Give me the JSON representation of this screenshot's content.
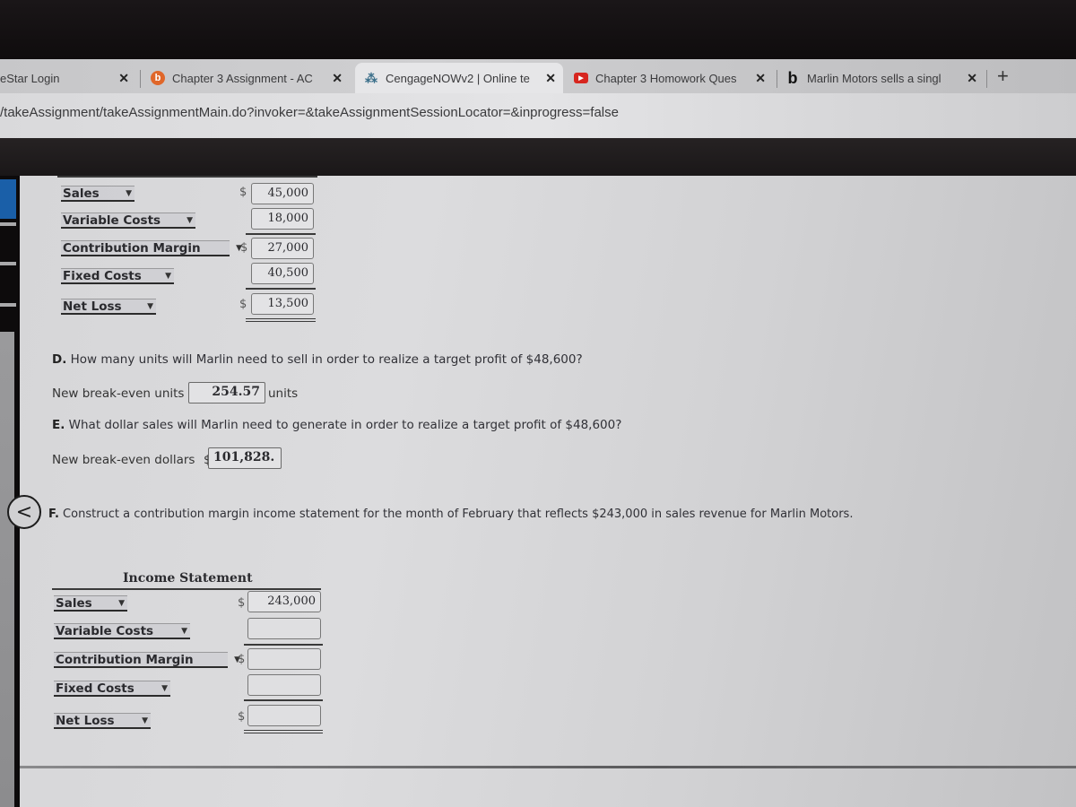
{
  "browser": {
    "tabs": [
      {
        "title": "eStar Login",
        "favicon": "none",
        "active": false
      },
      {
        "title": "Chapter 3 Assignment - AC",
        "favicon": "bartleby-b-icon",
        "favicon_color": "#e0672a",
        "active": false
      },
      {
        "title": "CengageNOWv2 | Online te",
        "favicon": "loading-spinner-icon",
        "active": true
      },
      {
        "title": "Chapter 3 Homowork Ques",
        "favicon": "youtube-icon",
        "favicon_color": "#d7261f",
        "active": false
      },
      {
        "title": "Marlin Motors sells a singl",
        "favicon": "bing-b-icon",
        "active": false
      }
    ],
    "close_glyph": "✕",
    "new_tab_glyph": "+",
    "url": "/takeAssignment/takeAssignmentMain.do?invoker=&takeAssignmentSessionLocator=&inprogress=false"
  },
  "nav": {
    "back_glyph": "<"
  },
  "statement1": {
    "rows": [
      {
        "label": "Sales",
        "dollar": "$",
        "value": "45,000"
      },
      {
        "label": "Variable Costs",
        "dollar": "",
        "value": "18,000"
      },
      {
        "label": "Contribution Margin",
        "dollar": "$",
        "value": "27,000"
      },
      {
        "label": "Fixed Costs",
        "dollar": "",
        "value": "40,500"
      },
      {
        "label": "Net Loss",
        "dollar": "$",
        "value": "13,500"
      }
    ]
  },
  "questionD": {
    "letter": "D.",
    "text": " How many units will Marlin need to sell in order to realize a target profit of $48,600?",
    "field_label": "New break-even units",
    "value": "254.57",
    "unit": "units"
  },
  "questionE": {
    "letter": "E.",
    "text": " What dollar sales will Marlin need to generate in order to realize a target profit of $48,600?",
    "field_label": "New break-even dollars",
    "dollar": "$",
    "value": "101,828."
  },
  "questionF": {
    "letter": "F.",
    "text": " Construct a contribution margin income statement for the month of February that reflects $243,000 in sales revenue for Marlin Motors."
  },
  "statement2": {
    "title": "Income Statement",
    "rows": [
      {
        "label": "Sales",
        "dollar": "$",
        "value": "243,000"
      },
      {
        "label": "Variable Costs",
        "dollar": "",
        "value": ""
      },
      {
        "label": "Contribution Margin",
        "dollar": "$",
        "value": ""
      },
      {
        "label": "Fixed Costs",
        "dollar": "",
        "value": ""
      },
      {
        "label": "Net Loss",
        "dollar": "$",
        "value": ""
      }
    ]
  },
  "dropdown_caret": "▼"
}
